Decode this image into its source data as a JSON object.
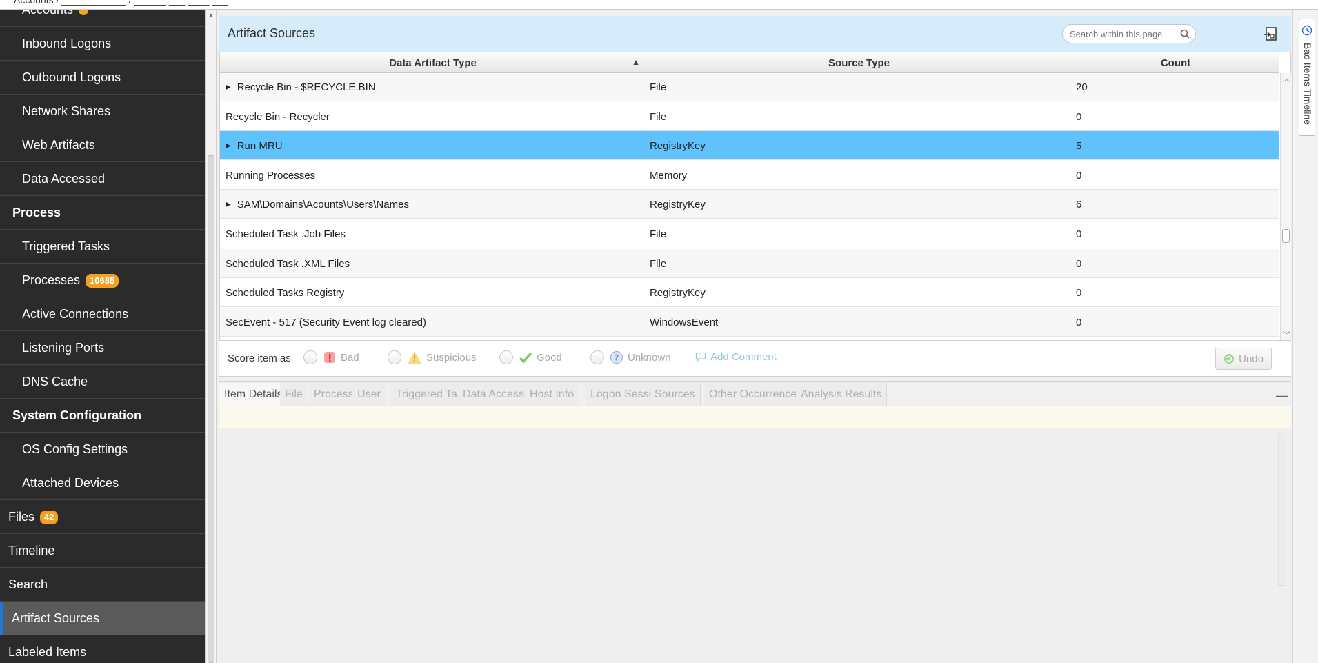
{
  "top_crumbs": "Accounts  /  ____________  /  ______ ___ ____ ___",
  "sidebar": {
    "items": [
      {
        "label": "Accounts",
        "kind": "sub",
        "badge": ""
      },
      {
        "label": "Inbound Logons",
        "kind": "sub"
      },
      {
        "label": "Outbound Logons",
        "kind": "sub"
      },
      {
        "label": "Network Shares",
        "kind": "sub"
      },
      {
        "label": "Web Artifacts",
        "kind": "sub"
      },
      {
        "label": "Data Accessed",
        "kind": "sub"
      },
      {
        "label": "Process",
        "kind": "section"
      },
      {
        "label": "Triggered Tasks",
        "kind": "sub"
      },
      {
        "label": "Processes",
        "kind": "sub",
        "badge": "10685"
      },
      {
        "label": "Active Connections",
        "kind": "sub"
      },
      {
        "label": "Listening Ports",
        "kind": "sub"
      },
      {
        "label": "DNS Cache",
        "kind": "sub"
      },
      {
        "label": "System Configuration",
        "kind": "section"
      },
      {
        "label": "OS Config Settings",
        "kind": "sub"
      },
      {
        "label": "Attached Devices",
        "kind": "sub"
      },
      {
        "label": "Files",
        "kind": "top",
        "badge": "42"
      },
      {
        "label": "Timeline",
        "kind": "top"
      },
      {
        "label": "Search",
        "kind": "top"
      },
      {
        "label": "Artifact Sources",
        "kind": "top",
        "active": true
      },
      {
        "label": "Labeled Items",
        "kind": "top"
      }
    ]
  },
  "header": {
    "title": "Artifact Sources",
    "search_placeholder": "Search within this page",
    "export_icon": "export-icon"
  },
  "table": {
    "columns": [
      "Data Artifact Type",
      "Source Type",
      "Count"
    ],
    "sort_column": "Data Artifact Type",
    "sort_direction": "ascending",
    "rows": [
      {
        "type": "Recycle Bin - $RECYCLE.BIN",
        "source": "File",
        "count": "20",
        "expandable": true
      },
      {
        "type": "Recycle Bin - Recycler",
        "source": "File",
        "count": "0",
        "expandable": false
      },
      {
        "type": "Run MRU",
        "source": "RegistryKey",
        "count": "5",
        "expandable": true,
        "selected": true
      },
      {
        "type": "Running Processes",
        "source": "Memory",
        "count": "0",
        "expandable": false
      },
      {
        "type": "SAM\\Domains\\Acounts\\Users\\Names",
        "source": "RegistryKey",
        "count": "6",
        "expandable": true
      },
      {
        "type": "Scheduled Task .Job Files",
        "source": "File",
        "count": "0",
        "expandable": false
      },
      {
        "type": "Scheduled Task .XML Files",
        "source": "File",
        "count": "0",
        "expandable": false
      },
      {
        "type": "Scheduled Tasks Registry",
        "source": "RegistryKey",
        "count": "0",
        "expandable": false
      },
      {
        "type": "SecEvent - 517 (Security Event log cleared)",
        "source": "WindowsEvent",
        "count": "0",
        "expandable": false
      }
    ]
  },
  "score": {
    "label": "Score item as",
    "options": [
      "Bad",
      "Suspicious",
      "Good",
      "Unknown"
    ],
    "add_comment": "Add Comment",
    "undo": "Undo"
  },
  "detail_tabs": [
    "Item Details",
    "File",
    "Process",
    "User",
    "Triggered Tasks",
    "Data Accessed",
    "Host Info",
    "Logon Session",
    "Sources",
    "Other Occurrences",
    "Analysis Results"
  ],
  "active_detail_tab": "Item Details",
  "right_dock": {
    "label": "Bad Items Timeline"
  },
  "colors": {
    "sidebar_bg": "#2b2b2b",
    "header_bg": "#d7ecfb",
    "selected_row": "#5fc2fd",
    "badge": "#f5a020",
    "active_marker": "#1e78d7"
  }
}
